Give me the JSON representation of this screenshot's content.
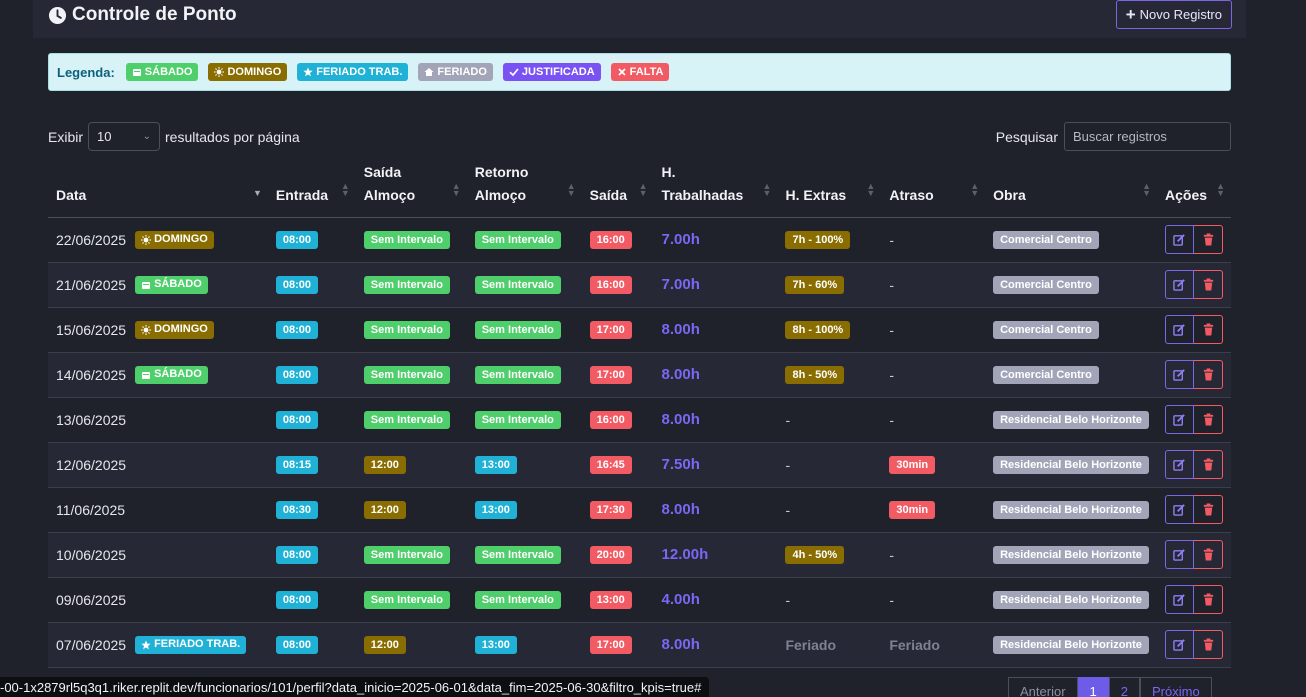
{
  "header": {
    "title": "Controle de Ponto",
    "new_button": "Novo Registro"
  },
  "legend": {
    "title": "Legenda:",
    "items": [
      {
        "label": "SÁBADO",
        "icon": "calendar-icon"
      },
      {
        "label": "DOMINGO",
        "icon": "sun-icon"
      },
      {
        "label": "FERIADO TRAB.",
        "icon": "star-icon"
      },
      {
        "label": "FERIADO",
        "icon": "home-icon"
      },
      {
        "label": "JUSTIFICADA",
        "icon": "check-icon"
      },
      {
        "label": "FALTA",
        "icon": "x-icon"
      }
    ]
  },
  "controls": {
    "show_label": "Exibir",
    "page_size": "10",
    "per_page_label": "resultados por página",
    "search_label": "Pesquisar",
    "search_placeholder": "Buscar registros"
  },
  "table": {
    "columns": [
      "Data",
      "Entrada",
      "Saída Almoço",
      "Retorno Almoço",
      "Saída",
      "H. Trabalhadas",
      "H. Extras",
      "Atraso",
      "Obra",
      "Ações"
    ],
    "rows": [
      {
        "date": "22/06/2025",
        "tag": "DOMINGO",
        "entrada": "08:00",
        "saida_almoco": "Sem Intervalo",
        "retorno": "Sem Intervalo",
        "saida": "16:00",
        "horas": "7.00h",
        "extras": "7h - 100%",
        "atraso": "-",
        "obra": "Comercial Centro"
      },
      {
        "date": "21/06/2025",
        "tag": "SÁBADO",
        "entrada": "08:00",
        "saida_almoco": "Sem Intervalo",
        "retorno": "Sem Intervalo",
        "saida": "16:00",
        "horas": "7.00h",
        "extras": "7h - 60%",
        "atraso": "-",
        "obra": "Comercial Centro"
      },
      {
        "date": "15/06/2025",
        "tag": "DOMINGO",
        "entrada": "08:00",
        "saida_almoco": "Sem Intervalo",
        "retorno": "Sem Intervalo",
        "saida": "17:00",
        "horas": "8.00h",
        "extras": "8h - 100%",
        "atraso": "-",
        "obra": "Comercial Centro"
      },
      {
        "date": "14/06/2025",
        "tag": "SÁBADO",
        "entrada": "08:00",
        "saida_almoco": "Sem Intervalo",
        "retorno": "Sem Intervalo",
        "saida": "17:00",
        "horas": "8.00h",
        "extras": "8h - 50%",
        "atraso": "-",
        "obra": "Comercial Centro"
      },
      {
        "date": "13/06/2025",
        "tag": "",
        "entrada": "08:00",
        "saida_almoco": "Sem Intervalo",
        "retorno": "Sem Intervalo",
        "saida": "16:00",
        "horas": "8.00h",
        "extras": "-",
        "atraso": "-",
        "obra": "Residencial Belo Horizonte"
      },
      {
        "date": "12/06/2025",
        "tag": "",
        "entrada": "08:15",
        "saida_almoco": "12:00",
        "retorno": "13:00",
        "saida": "16:45",
        "horas": "7.50h",
        "extras": "-",
        "atraso": "30min",
        "obra": "Residencial Belo Horizonte"
      },
      {
        "date": "11/06/2025",
        "tag": "",
        "entrada": "08:30",
        "saida_almoco": "12:00",
        "retorno": "13:00",
        "saida": "17:30",
        "horas": "8.00h",
        "extras": "-",
        "atraso": "30min",
        "obra": "Residencial Belo Horizonte"
      },
      {
        "date": "10/06/2025",
        "tag": "",
        "entrada": "08:00",
        "saida_almoco": "Sem Intervalo",
        "retorno": "Sem Intervalo",
        "saida": "20:00",
        "horas": "12.00h",
        "extras": "4h - 50%",
        "atraso": "-",
        "obra": "Residencial Belo Horizonte"
      },
      {
        "date": "09/06/2025",
        "tag": "",
        "entrada": "08:00",
        "saida_almoco": "Sem Intervalo",
        "retorno": "Sem Intervalo",
        "saida": "13:00",
        "horas": "4.00h",
        "extras": "-",
        "atraso": "-",
        "obra": "Residencial Belo Horizonte"
      },
      {
        "date": "07/06/2025",
        "tag": "FERIADO TRAB.",
        "entrada": "08:00",
        "saida_almoco": "12:00",
        "retorno": "13:00",
        "saida": "17:00",
        "horas": "8.00h",
        "extras": "Feriado",
        "atraso": "Feriado",
        "obra": "Residencial Belo Horizonte"
      }
    ]
  },
  "pagination": {
    "prev": "Anterior",
    "pages": [
      "1",
      "2"
    ],
    "next": "Próximo"
  },
  "status_url": "-00-1x2879rl5q3q1.riker.replit.dev/funcionarios/101/perfil?data_inicio=2025-06-01&data_fim=2025-06-30&filtro_kpis=true#"
}
